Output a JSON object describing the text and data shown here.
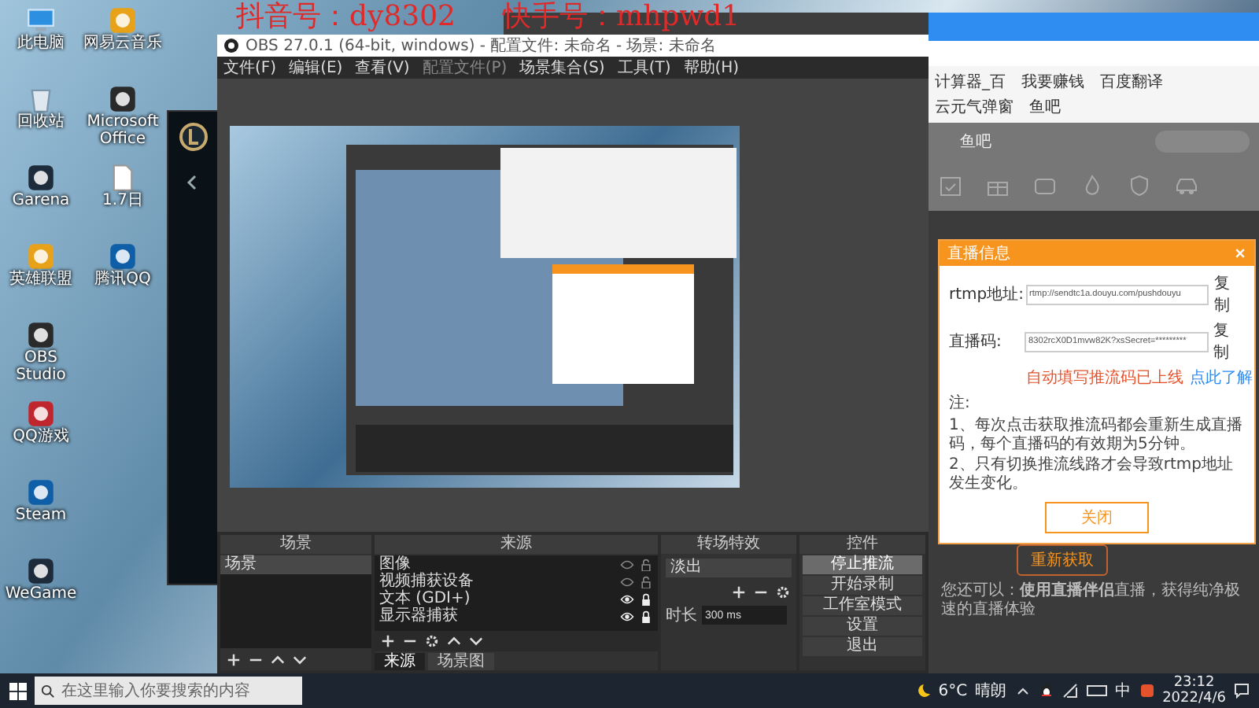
{
  "watermark": {
    "lines": [
      "抖音号：dy8302",
      "快手号：mhpwd1"
    ]
  },
  "desktop_icons": [
    {
      "label": "此电脑",
      "kind": "computer"
    },
    {
      "label": "回收站",
      "kind": "bin"
    },
    {
      "label": "Garena",
      "kind": "app"
    },
    {
      "label": "英雄联盟",
      "kind": "app"
    },
    {
      "label": "OBS Studio",
      "kind": "app"
    },
    {
      "label": "QQ游戏",
      "kind": "app"
    },
    {
      "label": "Steam",
      "kind": "app"
    },
    {
      "label": "WeGame",
      "kind": "app"
    },
    {
      "label": "网易云音乐",
      "kind": "app"
    },
    {
      "label": "Microsoft Office",
      "kind": "app"
    },
    {
      "label": "1.7日",
      "kind": "file"
    },
    {
      "label": "腾讯QQ",
      "kind": "app"
    }
  ],
  "browser": {
    "bookmarks": [
      "计算器_百",
      "我要赚钱",
      "百度翻译",
      "云元气弹窗",
      "鱼吧"
    ],
    "nav": "鱼吧",
    "dialog": {
      "title": "直播信息",
      "fields": [
        {
          "label": "rtmp地址:",
          "value": "rtmp://sendtc1a.douyu.com/pushdouyu",
          "action": "复制"
        },
        {
          "label": "直播码:",
          "value": "8302rcX0D1mvw82K?xsSecret=*********",
          "action": "复制"
        }
      ],
      "notice": "自动填写推流码已上线",
      "notice_link": "点此了解",
      "notes_title": "注:",
      "notes": [
        "1、每次点击获取推流码都会重新生成直播码，每个直播码的有效期为5分钟。",
        "2、只有切换推流线路才会导致rtmp地址发生变化。"
      ],
      "close_button": "关闭"
    },
    "refetch_button": "重新获取",
    "hint": "您还可以：**使用直播伴侣**直播，获得纯净极速的直播体验"
  },
  "obs": {
    "title": "OBS 27.0.1 (64-bit, windows) - 配置文件: 未命名 - 场景: 未命名",
    "menu": [
      "文件(F)",
      "编辑(E)",
      "查看(V)",
      "配置文件(P)",
      "场景集合(S)",
      "工具(T)",
      "帮助(H)"
    ],
    "scenes": {
      "title": "场景",
      "items": [
        {
          "label": "场景",
          "selected": true
        }
      ]
    },
    "sources": {
      "title": "来源",
      "items": [
        {
          "label": "图像",
          "visible": false,
          "locked": false
        },
        {
          "label": "视频捕获设备",
          "visible": false,
          "locked": false
        },
        {
          "label": "文本 (GDI+)",
          "visible": true,
          "locked": true
        },
        {
          "label": "显示器捕获",
          "visible": true,
          "locked": true
        }
      ],
      "tabs": [
        {
          "label": "来源",
          "selected": true
        },
        {
          "label": "场景图",
          "selected": false
        }
      ]
    },
    "transitions": {
      "title": "转场特效",
      "transition": "淡出",
      "duration_label": "时长",
      "duration": "300 ms"
    },
    "controls": {
      "title": "控件",
      "buttons": [
        {
          "label": "停止推流",
          "highlighted": true
        },
        {
          "label": "开始录制",
          "highlighted": false
        },
        {
          "label": "工作室模式",
          "highlighted": false
        },
        {
          "label": "设置",
          "highlighted": false
        },
        {
          "label": "退出",
          "highlighted": false
        }
      ]
    }
  },
  "taskbar": {
    "search_placeholder": "在这里输入你要搜索的内容",
    "temperature": "6°C",
    "weather": "晴朗",
    "ime": "中",
    "time": "23:12",
    "date": "2022/4/6"
  }
}
